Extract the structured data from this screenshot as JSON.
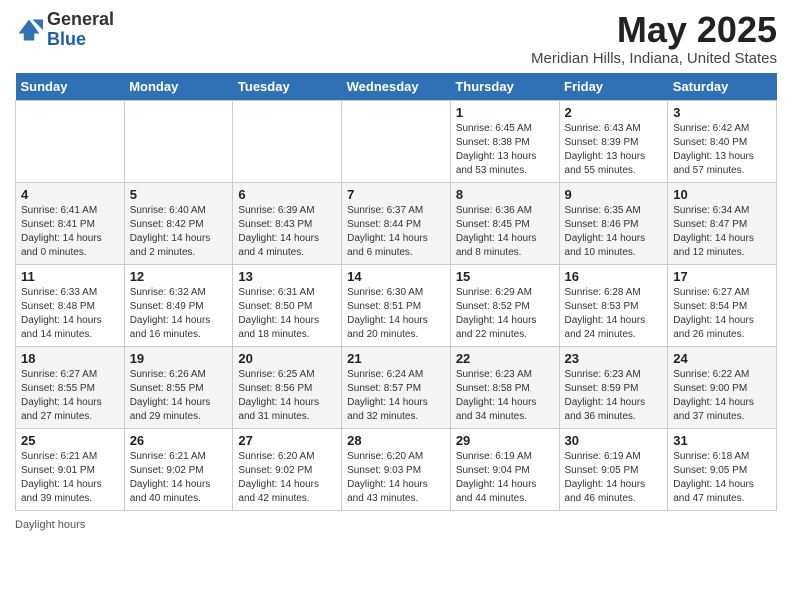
{
  "header": {
    "logo_general": "General",
    "logo_blue": "Blue",
    "month_title": "May 2025",
    "subtitle": "Meridian Hills, Indiana, United States"
  },
  "days_of_week": [
    "Sunday",
    "Monday",
    "Tuesday",
    "Wednesday",
    "Thursday",
    "Friday",
    "Saturday"
  ],
  "footer": {
    "daylight_label": "Daylight hours"
  },
  "weeks": [
    [
      {
        "day": "",
        "info": ""
      },
      {
        "day": "",
        "info": ""
      },
      {
        "day": "",
        "info": ""
      },
      {
        "day": "",
        "info": ""
      },
      {
        "day": "1",
        "info": "Sunrise: 6:45 AM\nSunset: 8:38 PM\nDaylight: 13 hours\nand 53 minutes."
      },
      {
        "day": "2",
        "info": "Sunrise: 6:43 AM\nSunset: 8:39 PM\nDaylight: 13 hours\nand 55 minutes."
      },
      {
        "day": "3",
        "info": "Sunrise: 6:42 AM\nSunset: 8:40 PM\nDaylight: 13 hours\nand 57 minutes."
      }
    ],
    [
      {
        "day": "4",
        "info": "Sunrise: 6:41 AM\nSunset: 8:41 PM\nDaylight: 14 hours\nand 0 minutes."
      },
      {
        "day": "5",
        "info": "Sunrise: 6:40 AM\nSunset: 8:42 PM\nDaylight: 14 hours\nand 2 minutes."
      },
      {
        "day": "6",
        "info": "Sunrise: 6:39 AM\nSunset: 8:43 PM\nDaylight: 14 hours\nand 4 minutes."
      },
      {
        "day": "7",
        "info": "Sunrise: 6:37 AM\nSunset: 8:44 PM\nDaylight: 14 hours\nand 6 minutes."
      },
      {
        "day": "8",
        "info": "Sunrise: 6:36 AM\nSunset: 8:45 PM\nDaylight: 14 hours\nand 8 minutes."
      },
      {
        "day": "9",
        "info": "Sunrise: 6:35 AM\nSunset: 8:46 PM\nDaylight: 14 hours\nand 10 minutes."
      },
      {
        "day": "10",
        "info": "Sunrise: 6:34 AM\nSunset: 8:47 PM\nDaylight: 14 hours\nand 12 minutes."
      }
    ],
    [
      {
        "day": "11",
        "info": "Sunrise: 6:33 AM\nSunset: 8:48 PM\nDaylight: 14 hours\nand 14 minutes."
      },
      {
        "day": "12",
        "info": "Sunrise: 6:32 AM\nSunset: 8:49 PM\nDaylight: 14 hours\nand 16 minutes."
      },
      {
        "day": "13",
        "info": "Sunrise: 6:31 AM\nSunset: 8:50 PM\nDaylight: 14 hours\nand 18 minutes."
      },
      {
        "day": "14",
        "info": "Sunrise: 6:30 AM\nSunset: 8:51 PM\nDaylight: 14 hours\nand 20 minutes."
      },
      {
        "day": "15",
        "info": "Sunrise: 6:29 AM\nSunset: 8:52 PM\nDaylight: 14 hours\nand 22 minutes."
      },
      {
        "day": "16",
        "info": "Sunrise: 6:28 AM\nSunset: 8:53 PM\nDaylight: 14 hours\nand 24 minutes."
      },
      {
        "day": "17",
        "info": "Sunrise: 6:27 AM\nSunset: 8:54 PM\nDaylight: 14 hours\nand 26 minutes."
      }
    ],
    [
      {
        "day": "18",
        "info": "Sunrise: 6:27 AM\nSunset: 8:55 PM\nDaylight: 14 hours\nand 27 minutes."
      },
      {
        "day": "19",
        "info": "Sunrise: 6:26 AM\nSunset: 8:55 PM\nDaylight: 14 hours\nand 29 minutes."
      },
      {
        "day": "20",
        "info": "Sunrise: 6:25 AM\nSunset: 8:56 PM\nDaylight: 14 hours\nand 31 minutes."
      },
      {
        "day": "21",
        "info": "Sunrise: 6:24 AM\nSunset: 8:57 PM\nDaylight: 14 hours\nand 32 minutes."
      },
      {
        "day": "22",
        "info": "Sunrise: 6:23 AM\nSunset: 8:58 PM\nDaylight: 14 hours\nand 34 minutes."
      },
      {
        "day": "23",
        "info": "Sunrise: 6:23 AM\nSunset: 8:59 PM\nDaylight: 14 hours\nand 36 minutes."
      },
      {
        "day": "24",
        "info": "Sunrise: 6:22 AM\nSunset: 9:00 PM\nDaylight: 14 hours\nand 37 minutes."
      }
    ],
    [
      {
        "day": "25",
        "info": "Sunrise: 6:21 AM\nSunset: 9:01 PM\nDaylight: 14 hours\nand 39 minutes."
      },
      {
        "day": "26",
        "info": "Sunrise: 6:21 AM\nSunset: 9:02 PM\nDaylight: 14 hours\nand 40 minutes."
      },
      {
        "day": "27",
        "info": "Sunrise: 6:20 AM\nSunset: 9:02 PM\nDaylight: 14 hours\nand 42 minutes."
      },
      {
        "day": "28",
        "info": "Sunrise: 6:20 AM\nSunset: 9:03 PM\nDaylight: 14 hours\nand 43 minutes."
      },
      {
        "day": "29",
        "info": "Sunrise: 6:19 AM\nSunset: 9:04 PM\nDaylight: 14 hours\nand 44 minutes."
      },
      {
        "day": "30",
        "info": "Sunrise: 6:19 AM\nSunset: 9:05 PM\nDaylight: 14 hours\nand 46 minutes."
      },
      {
        "day": "31",
        "info": "Sunrise: 6:18 AM\nSunset: 9:05 PM\nDaylight: 14 hours\nand 47 minutes."
      }
    ]
  ]
}
